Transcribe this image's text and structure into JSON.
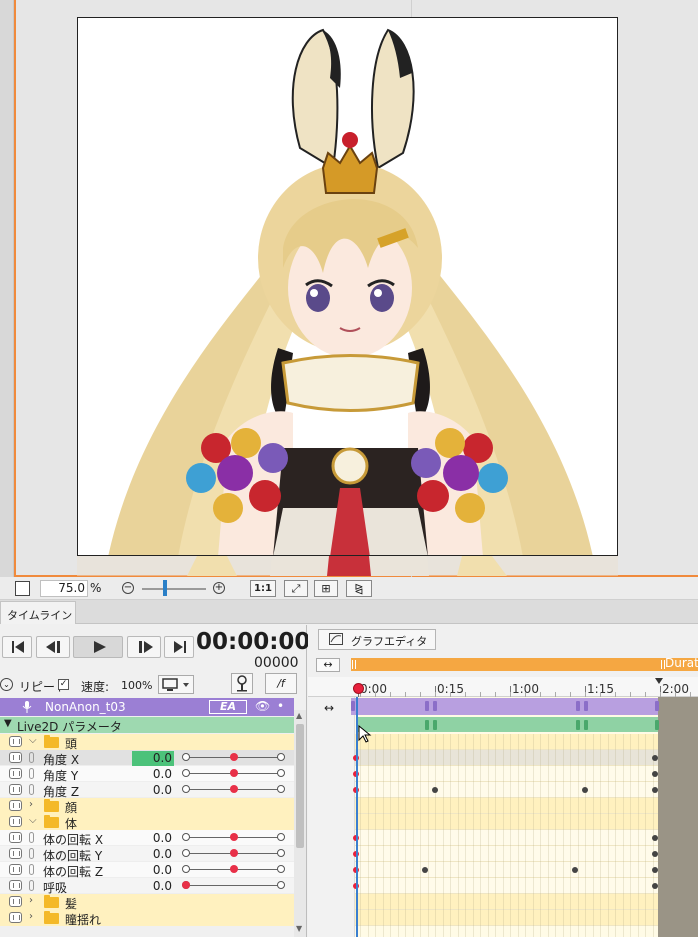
{
  "canvas": {
    "zoom_value": "75.0",
    "zoom_unit": "%",
    "ratio_label": "1:1"
  },
  "tabs": {
    "timeline": "タイムライン"
  },
  "transport": {
    "timecode": "00:00:00",
    "frame": "00000",
    "repeat_label": "リピート",
    "speed_label": "速度:",
    "speed_value": "100%",
    "fx_label": "/f"
  },
  "layer": {
    "name": "NonAnon_t03",
    "badge": "EA"
  },
  "group_title": "Live2D パラメータ",
  "rows": [
    {
      "type": "folder",
      "label": "頭",
      "open": true
    },
    {
      "type": "param",
      "label": "角度 X",
      "value": "0.0",
      "knob": 0.5,
      "selected": true
    },
    {
      "type": "param",
      "label": "角度 Y",
      "value": "0.0",
      "knob": 0.5
    },
    {
      "type": "param",
      "label": "角度 Z",
      "value": "0.0",
      "knob": 0.5
    },
    {
      "type": "folder",
      "label": "顔",
      "open": false
    },
    {
      "type": "folder",
      "label": "体",
      "open": true
    },
    {
      "type": "param",
      "label": "体の回転 X",
      "value": "0.0",
      "knob": 0.5
    },
    {
      "type": "param",
      "label": "体の回転 Y",
      "value": "0.0",
      "knob": 0.5
    },
    {
      "type": "param",
      "label": "体の回転 Z",
      "value": "0.0",
      "knob": 0.5
    },
    {
      "type": "param",
      "label": "呼吸",
      "value": "0.0",
      "knob": 0.0
    },
    {
      "type": "folder",
      "label": "髪",
      "open": false
    },
    {
      "type": "folder",
      "label": "瞳揺れ",
      "open": false
    }
  ],
  "graph_editor": {
    "label": "グラフエディタ"
  },
  "duration_label": "Durat",
  "ruler": [
    "0:00",
    "0:15",
    "1:00",
    "1:15",
    "2:00"
  ],
  "colors": {
    "accent_orange": "#f08a3c",
    "layer_purple": "#9b7fd4",
    "group_green": "#9ed9b0",
    "keyframe_red": "#e8203c",
    "value_green": "#4cc27a"
  }
}
